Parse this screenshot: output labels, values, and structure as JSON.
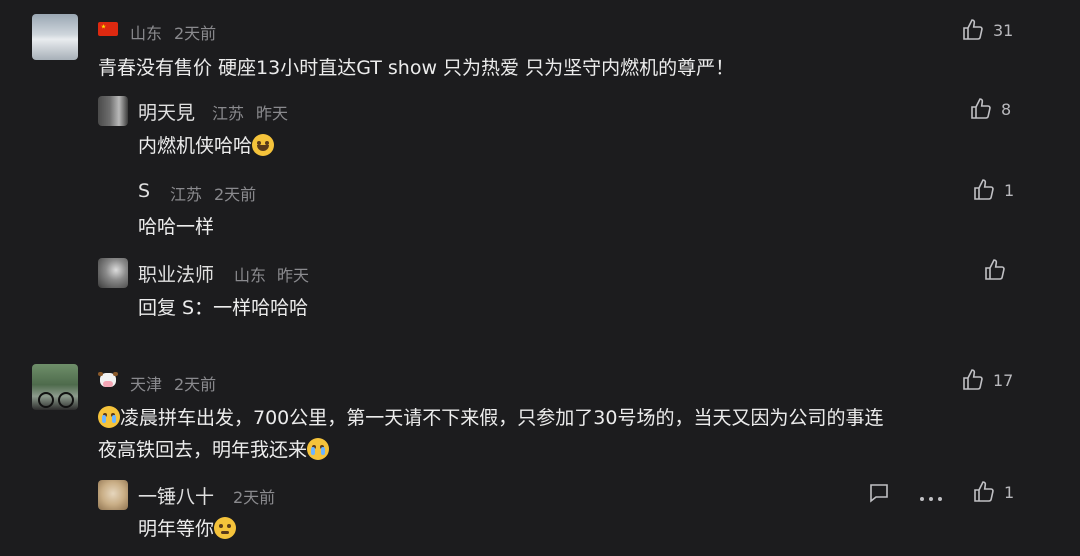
{
  "comments": [
    {
      "location": "山东",
      "time": "2天前",
      "text": "青春没有售价  硬座13小时直达GT show  只为热爱  只为坚守内燃机的尊严！",
      "likes": "31",
      "replies": [
        {
          "name": "明天見",
          "location": "江苏",
          "time": "昨天",
          "text": "内燃机侠哈哈",
          "likes": "8"
        },
        {
          "name": "S",
          "location": "江苏",
          "time": "2天前",
          "text": "哈哈一样",
          "likes": "1"
        },
        {
          "name": "职业法师",
          "location": "山东",
          "time": "昨天",
          "text": "回复 S：一样哈哈哈",
          "likes": ""
        }
      ]
    },
    {
      "location": "天津",
      "time": "2天前",
      "text_line1": "凌晨拼车出发，700公里，第一天请不下来假，只参加了30号场的，当天又因为公司的事连",
      "text_line2": "夜高铁回去，明年我还来",
      "likes": "17",
      "replies": [
        {
          "name": "一锤八十",
          "location": "2天前",
          "time": "",
          "text": "明年等你",
          "likes": "1"
        }
      ]
    }
  ],
  "icons": {
    "like": "thumbs-up-icon",
    "comment": "comment-icon",
    "more": "more-icon"
  }
}
